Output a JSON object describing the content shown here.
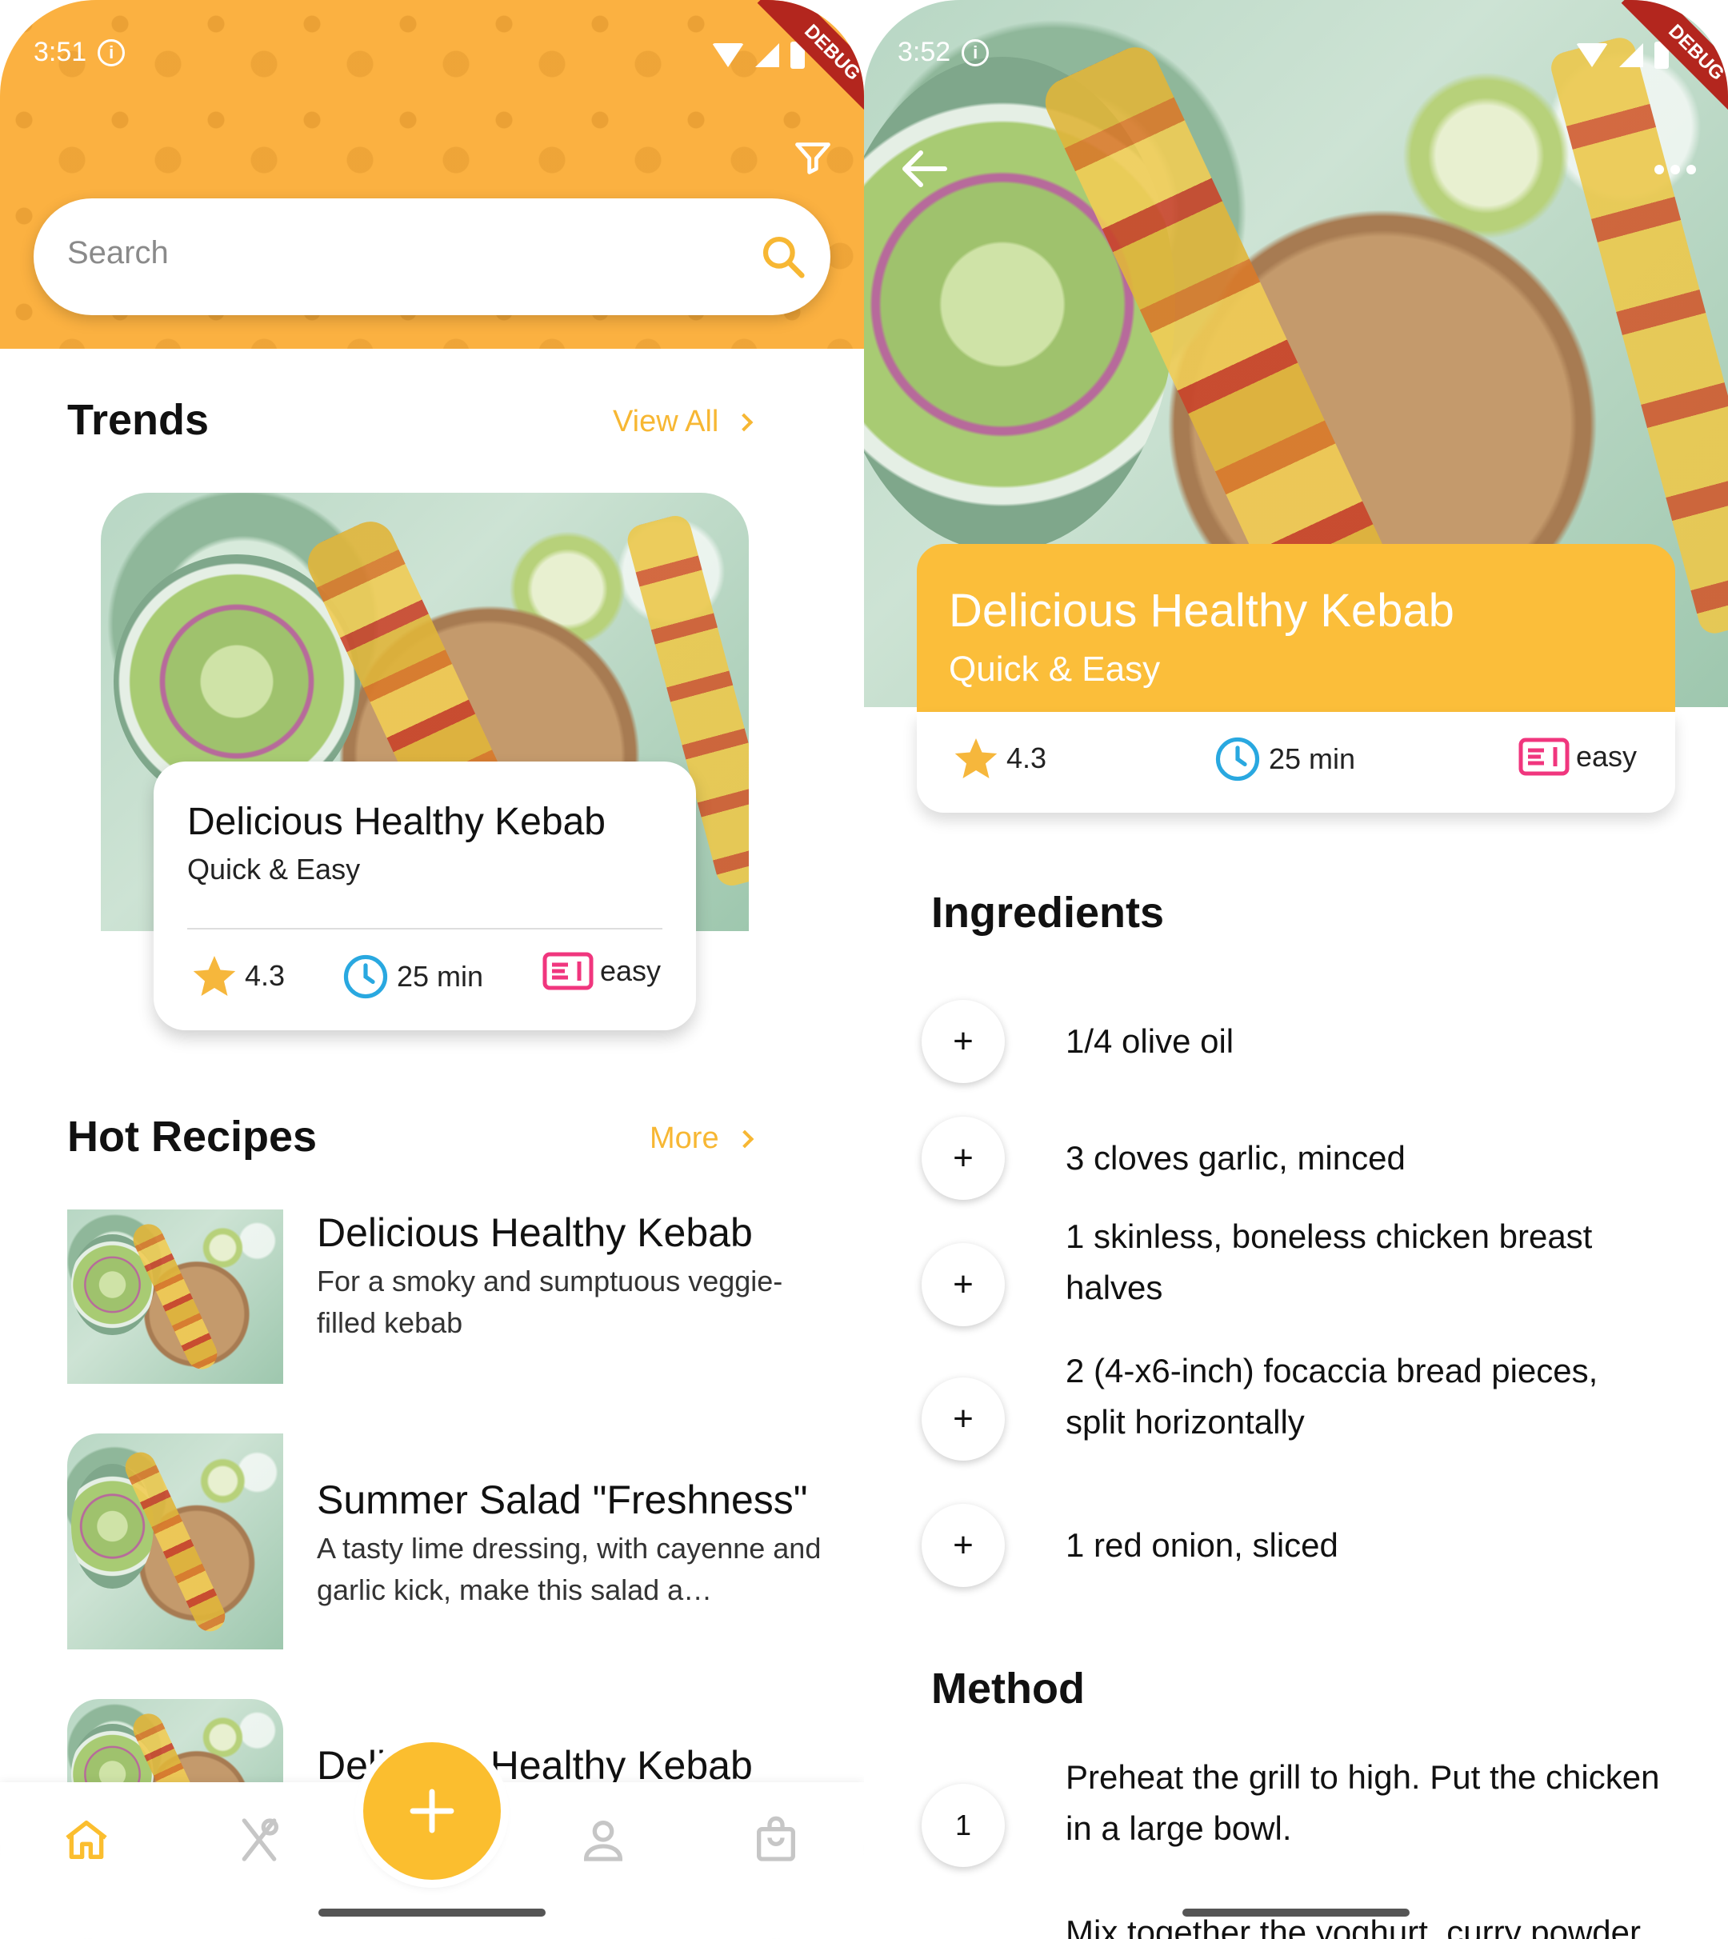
{
  "left": {
    "status_time": "3:51",
    "debug_label": "DEBUG",
    "search_placeholder": "Search",
    "trends_title": "Trends",
    "trends_link": "View All",
    "trend_card": {
      "title": "Delicious Healthy Kebab",
      "subtitle": "Quick & Easy",
      "rating": "4.3",
      "time": "25 min",
      "difficulty": "easy"
    },
    "hot_title": "Hot Recipes",
    "hot_link": "More",
    "hot_items": [
      {
        "title": "Delicious Healthy Kebab",
        "desc": "For a smoky and sumptuous veggie-filled kebab"
      },
      {
        "title": "Summer Salad \"Freshness\"",
        "desc": "A tasty lime dressing, with cayenne and garlic kick, make this salad a…"
      },
      {
        "title": "Delicious Healthy Kebab",
        "desc": ""
      }
    ],
    "nav_icons": [
      "home-icon",
      "restaurant-icon",
      "add-icon",
      "profile-icon",
      "shopping-bag-icon"
    ],
    "colors": {
      "accent": "#fbbe2f",
      "header": "#fbb141",
      "link": "#f7b733",
      "difficulty": "#f0367e",
      "clock": "#29a8e0"
    }
  },
  "right": {
    "status_time": "3:52",
    "debug_label": "DEBUG",
    "title": "Delicious Healthy Kebab",
    "subtitle": "Quick & Easy",
    "rating": "4.3",
    "time": "25 min",
    "difficulty": "easy",
    "ingredients_title": "Ingredients",
    "ingredients": [
      "1/4 olive oil",
      "3 cloves garlic, minced",
      "1 skinless, boneless chicken breast halves",
      "2 (4-x6-inch) focaccia bread pieces, split horizontally",
      "1 red onion, sliced"
    ],
    "ingredient_button": "+",
    "method_title": "Method",
    "method": [
      {
        "step": "1",
        "text": "Preheat the grill to high. Put the chicken in a large bowl."
      },
      {
        "step": "",
        "text": "Mix together the yoghurt, curry powder"
      }
    ]
  }
}
